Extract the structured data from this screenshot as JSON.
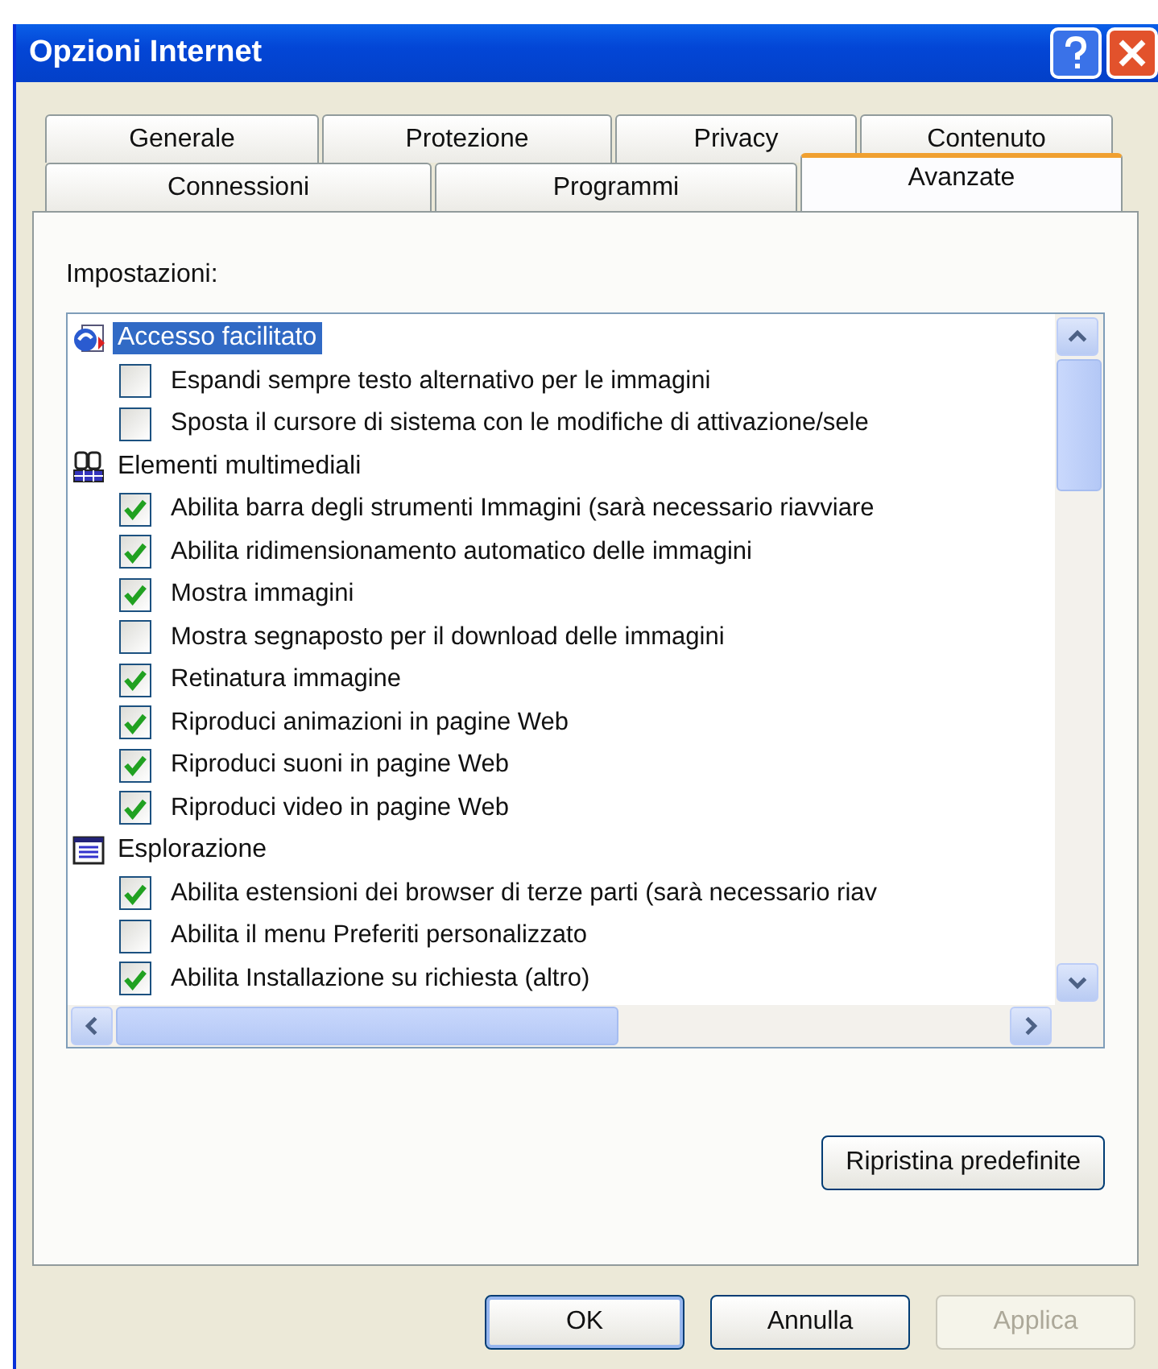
{
  "window": {
    "title": "Opzioni Internet"
  },
  "tab_rows": [
    [
      {
        "label": "Generale",
        "selected": false
      },
      {
        "label": "Protezione",
        "selected": false
      },
      {
        "label": "Privacy",
        "selected": false
      },
      {
        "label": "Contenuto",
        "selected": false
      }
    ],
    [
      {
        "label": "Connessioni",
        "selected": false
      },
      {
        "label": "Programmi",
        "selected": false
      },
      {
        "label": "Avanzate",
        "selected": true
      }
    ]
  ],
  "settings_label": "Impostazioni:",
  "settings": [
    {
      "label": "Accesso facilitato",
      "selected": true,
      "children": [
        {
          "label": "Espandi sempre testo alternativo per le immagini",
          "checked": false
        },
        {
          "label": "Sposta il cursore di sistema con le modifiche di attivazione/sele",
          "checked": false
        }
      ]
    },
    {
      "label": "Elementi multimediali",
      "selected": false,
      "children": [
        {
          "label": "Abilita barra degli strumenti Immagini (sarà necessario riavviare",
          "checked": true
        },
        {
          "label": "Abilita ridimensionamento automatico delle immagini",
          "checked": true
        },
        {
          "label": "Mostra immagini",
          "checked": true
        },
        {
          "label": "Mostra segnaposto per il download delle immagini",
          "checked": false
        },
        {
          "label": "Retinatura immagine",
          "checked": true
        },
        {
          "label": "Riproduci animazioni in pagine Web",
          "checked": true
        },
        {
          "label": "Riproduci suoni in pagine Web",
          "checked": true
        },
        {
          "label": "Riproduci video in pagine Web",
          "checked": true
        }
      ]
    },
    {
      "label": "Esplorazione",
      "selected": false,
      "children": [
        {
          "label": "Abilita estensioni dei browser di terze parti (sarà necessario riav",
          "checked": true
        },
        {
          "label": "Abilita il menu Preferiti personalizzato",
          "checked": false
        },
        {
          "label": "Abilita Installazione su richiesta (altro)",
          "checked": true
        }
      ]
    }
  ],
  "restore_button": "Ripristina predefinite",
  "buttons": [
    {
      "label": "OK",
      "disabled": false,
      "default": true
    },
    {
      "label": "Annulla",
      "disabled": false,
      "default": false
    },
    {
      "label": "Applica",
      "disabled": true,
      "default": false
    }
  ]
}
